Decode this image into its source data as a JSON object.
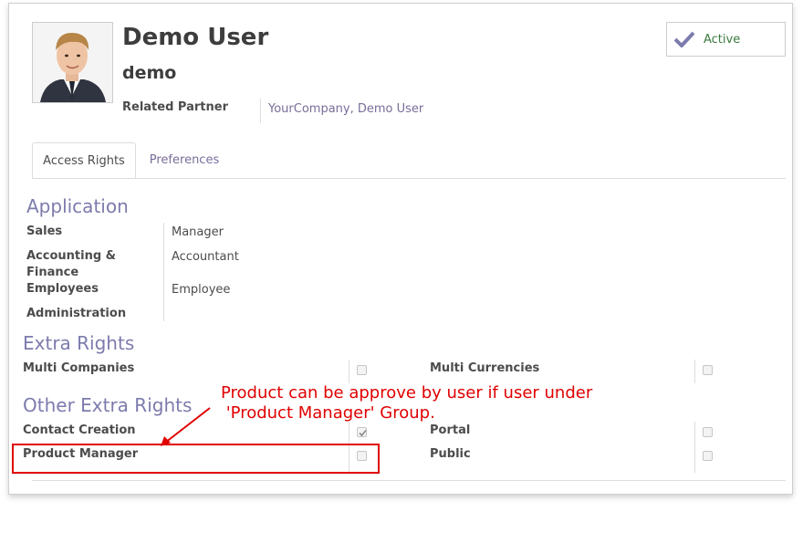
{
  "user": {
    "name": "Demo User",
    "login": "demo",
    "related_partner_label": "Related Partner",
    "related_partner_value": "YourCompany, Demo User",
    "status_label": "Active"
  },
  "tabs": [
    {
      "label": "Access Rights",
      "active": true
    },
    {
      "label": "Preferences",
      "active": false
    }
  ],
  "application": {
    "heading": "Application",
    "rows": [
      {
        "label": "Sales",
        "value": "Manager"
      },
      {
        "label": "Accounting & Finance",
        "value": "Accountant"
      },
      {
        "label": "Employees",
        "value": "Employee"
      },
      {
        "label": "Administration",
        "value": ""
      }
    ]
  },
  "extra_rights": {
    "heading": "Extra Rights",
    "left": {
      "label": "Multi Companies",
      "checked": false
    },
    "right": {
      "label": "Multi Currencies",
      "checked": false
    }
  },
  "other_extra_rights": {
    "heading": "Other Extra Rights",
    "rows": [
      {
        "left_label": "Contact Creation",
        "left_checked": true,
        "right_label": "Portal",
        "right_checked": false
      },
      {
        "left_label": "Product Manager",
        "left_checked": false,
        "right_label": "Public",
        "right_checked": false
      }
    ]
  },
  "annotation": {
    "line1": "Product can be approve by user if user under",
    "line2": " 'Product Manager' Group."
  },
  "colors": {
    "section_heading": "#7c7bad",
    "link": "#7a6d9a",
    "status_check": "#7c7bad",
    "annotation": "#e00000"
  },
  "icons": {
    "status": "check-icon",
    "avatar": "user-photo"
  }
}
